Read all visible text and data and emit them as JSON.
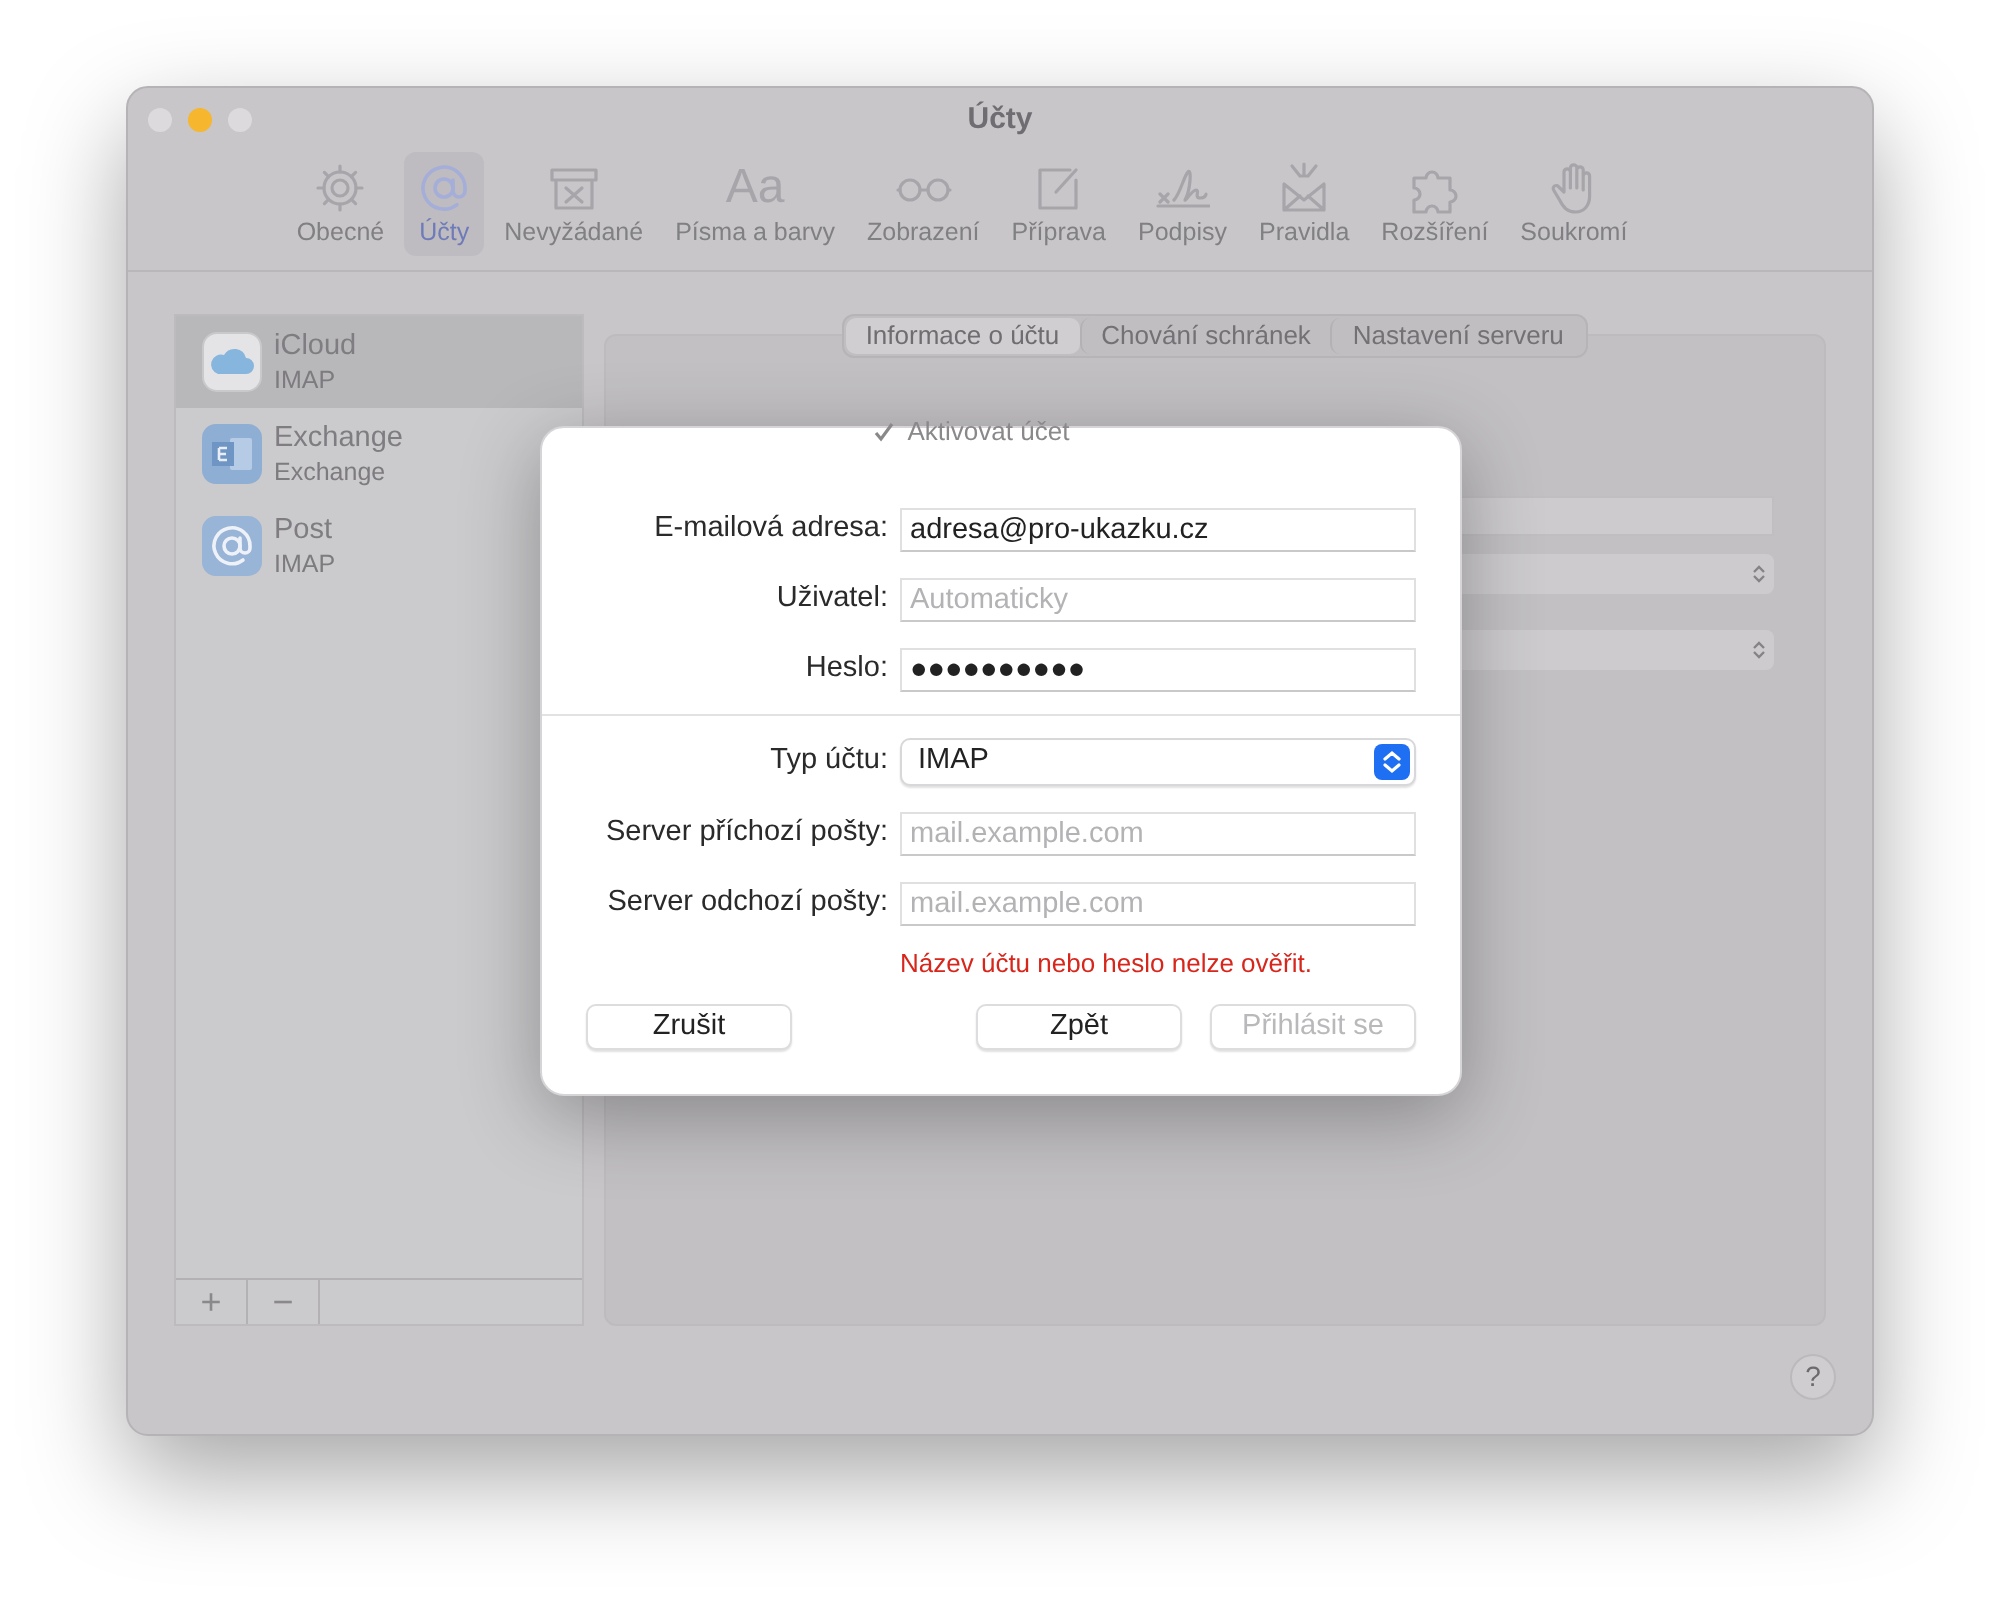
{
  "window": {
    "title": "Účty"
  },
  "toolbar": [
    {
      "label": "Obecné",
      "selected": false
    },
    {
      "label": "Účty",
      "selected": true
    },
    {
      "label": "Nevyžádané",
      "selected": false
    },
    {
      "glyph": "Aa",
      "label": "Písma a barvy",
      "selected": false
    },
    {
      "label": "Zobrazení",
      "selected": false
    },
    {
      "label": "Příprava",
      "selected": false
    },
    {
      "label": "Podpisy",
      "selected": false
    },
    {
      "label": "Pravidla",
      "selected": false
    },
    {
      "label": "Rozšíření",
      "selected": false
    },
    {
      "label": "Soukromí",
      "selected": false
    }
  ],
  "accounts": [
    {
      "name": "iCloud",
      "type": "IMAP",
      "selected": true
    },
    {
      "name": "Exchange",
      "type": "Exchange",
      "selected": false
    },
    {
      "name": "Post",
      "type": "IMAP",
      "selected": false
    }
  ],
  "list_buttons": [
    "+",
    "−"
  ],
  "tabs": [
    {
      "label": "Informace o účtu",
      "selected": true
    },
    {
      "label": "Chování schránek",
      "selected": false
    },
    {
      "label": "Nastavení serveru",
      "selected": false
    }
  ],
  "background_form": {
    "checkbox": {
      "label": "Aktivovat účet",
      "checked": true
    }
  },
  "dialog": {
    "groups": [
      [
        {
          "kind": "text",
          "label": "E-mailová adresa:",
          "value": "adresa@pro-ukazku.cz"
        },
        {
          "kind": "text",
          "label": "Uživatel:",
          "placeholder": "Automaticky"
        },
        {
          "kind": "text",
          "label": "Heslo:",
          "value": "●●●●●●●●●●"
        }
      ],
      [
        {
          "kind": "popup",
          "label": "Typ účtu:",
          "value": "IMAP"
        },
        {
          "kind": "text",
          "label": "Server příchozí pošty:",
          "placeholder": "mail.example.com"
        },
        {
          "kind": "text",
          "label": "Server odchozí pošty:",
          "placeholder": "mail.example.com"
        }
      ]
    ],
    "error": "Název účtu nebo heslo nelze ověřit.",
    "buttons": [
      {
        "label": "Zrušit",
        "disabled": false
      },
      {
        "label": "Zpět",
        "disabled": false
      },
      {
        "label": "Přihlásit se",
        "disabled": true
      }
    ]
  },
  "help_button": "?"
}
